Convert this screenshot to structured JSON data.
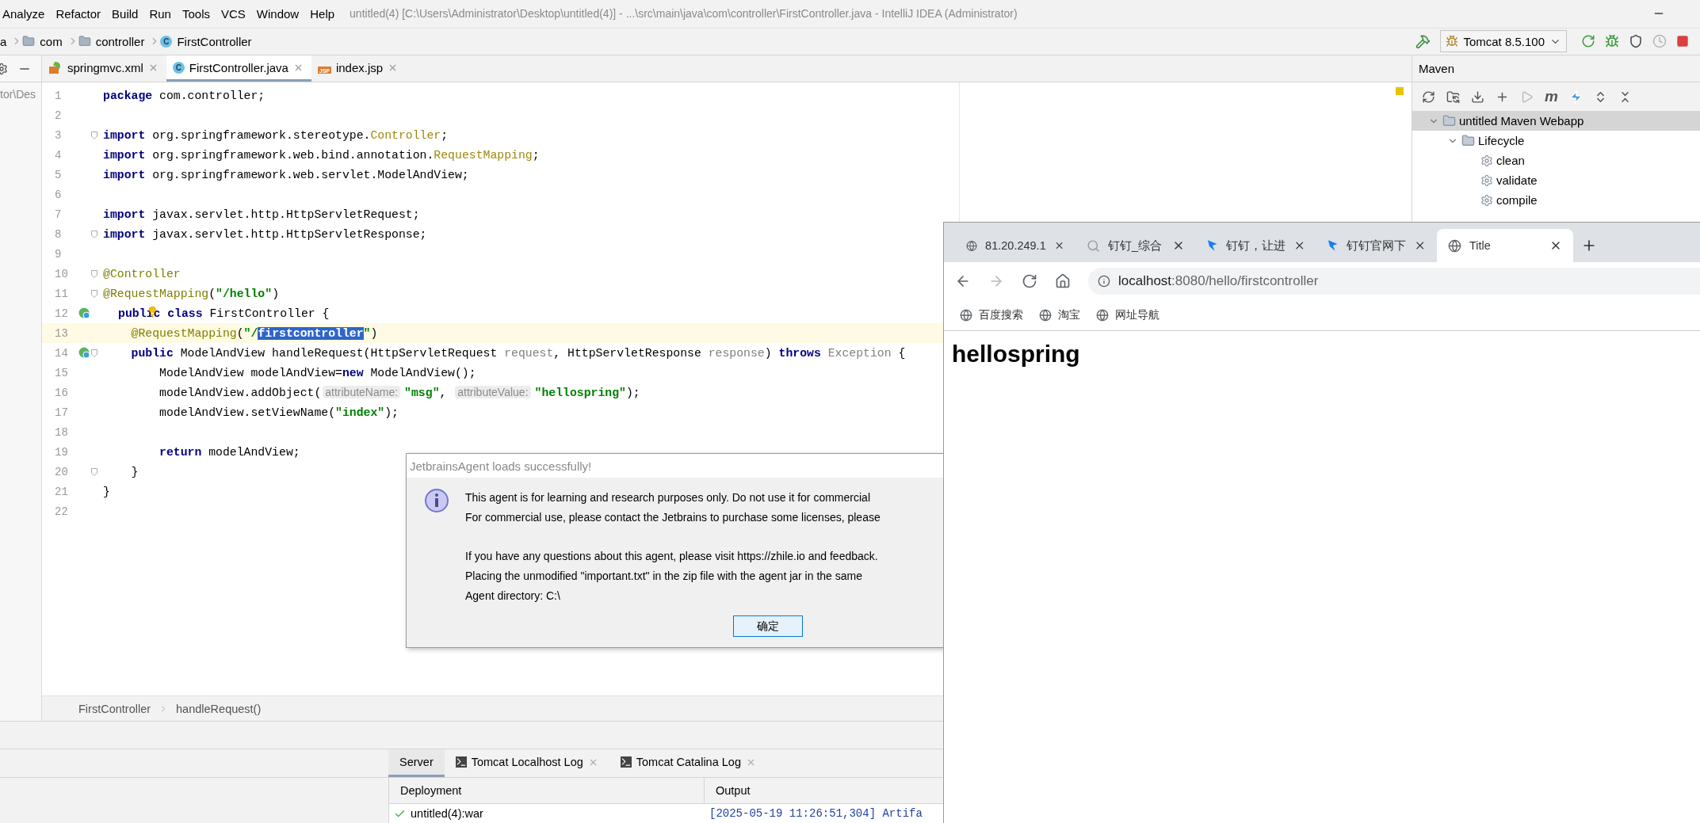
{
  "menu": [
    "Analyze",
    "Refactor",
    "Build",
    "Run",
    "Tools",
    "VCS",
    "Window",
    "Help"
  ],
  "window": {
    "title": "untitled(4) [C:\\Users\\Administrator\\Desktop\\untitled(4)] - ...\\src\\main\\java\\com\\controller\\FirstController.java - IntelliJ IDEA (Administrator)"
  },
  "breadcrumbs": [
    {
      "label": "a",
      "kind": "text"
    },
    {
      "label": "com",
      "kind": "folder"
    },
    {
      "label": "controller",
      "kind": "folder"
    },
    {
      "label": "FirstController",
      "kind": "class",
      "badge": "C"
    }
  ],
  "run_config": {
    "label": "Tomcat 8.5.100"
  },
  "project_panel": {
    "path": "tor\\Des"
  },
  "editor_tabs": [
    {
      "label": "springmvc.xml",
      "kind": "xml",
      "selected": false
    },
    {
      "label": "FirstController.java",
      "kind": "class",
      "badge": "C",
      "selected": true
    },
    {
      "label": "index.jsp",
      "kind": "jsp",
      "badge": "JSP",
      "selected": false
    }
  ],
  "code": [
    {
      "n": "1",
      "tokens": [
        {
          "t": "package ",
          "kind": "kw"
        },
        {
          "t": "com.controller;",
          "kind": "plain"
        }
      ]
    },
    {
      "n": "2"
    },
    {
      "n": "3",
      "fold": true,
      "tokens": [
        {
          "t": "import ",
          "kind": "kw"
        },
        {
          "t": "org.springframework.stereotype.",
          "kind": "plain"
        },
        {
          "t": "Controller",
          "kind": "imp"
        },
        {
          "t": ";",
          "kind": "plain"
        }
      ]
    },
    {
      "n": "4",
      "tokens": [
        {
          "t": "import ",
          "kind": "kw"
        },
        {
          "t": "org.springframework.web.bind.annotation.",
          "kind": "plain"
        },
        {
          "t": "RequestMapping",
          "kind": "imp"
        },
        {
          "t": ";",
          "kind": "plain"
        }
      ]
    },
    {
      "n": "5",
      "tokens": [
        {
          "t": "import ",
          "kind": "kw"
        },
        {
          "t": "org.springframework.web.servlet.ModelAndView;",
          "kind": "plain"
        }
      ]
    },
    {
      "n": "6"
    },
    {
      "n": "7",
      "tokens": [
        {
          "t": "import ",
          "kind": "kw"
        },
        {
          "t": "javax.servlet.http.HttpServletRequest;",
          "kind": "plain"
        }
      ]
    },
    {
      "n": "8",
      "fold": true,
      "tokens": [
        {
          "t": "import ",
          "kind": "kw"
        },
        {
          "t": "javax.servlet.http.HttpServletResponse;",
          "kind": "plain"
        }
      ]
    },
    {
      "n": "9"
    },
    {
      "n": "10",
      "fold": true,
      "tokens": [
        {
          "t": "@Controller",
          "kind": "ann"
        }
      ]
    },
    {
      "n": "11",
      "fold": true,
      "tokens": [
        {
          "t": "@RequestMapping",
          "kind": "ann"
        },
        {
          "t": "(",
          "kind": "plain"
        },
        {
          "t": "\"/hello\"",
          "kind": "str"
        },
        {
          "t": ")",
          "kind": "plain"
        }
      ]
    },
    {
      "n": "12",
      "run_marker": true,
      "bulb": true,
      "tokens": [
        {
          "t": "public ",
          "kind": "kw"
        },
        {
          "t": "class ",
          "kind": "kw"
        },
        {
          "t": "FirstController {",
          "kind": "plain"
        }
      ]
    },
    {
      "n": "13",
      "current": true,
      "tokens": [
        {
          "t": "    @RequestMapping",
          "kind": "ann"
        },
        {
          "t": "(",
          "kind": "plain"
        },
        {
          "t": "\"/",
          "kind": "str"
        },
        {
          "t": "firstcontroller",
          "kind": "sel"
        },
        {
          "t": "\"",
          "kind": "str"
        },
        {
          "t": ")",
          "kind": "plain"
        }
      ]
    },
    {
      "n": "14",
      "run_marker": true,
      "fold": true,
      "tokens": [
        {
          "t": "    public ",
          "kind": "kw"
        },
        {
          "t": "ModelAndView handleRequest(HttpServletRequest ",
          "kind": "plain"
        },
        {
          "t": "request",
          "kind": "gray"
        },
        {
          "t": ", HttpServletResponse ",
          "kind": "plain"
        },
        {
          "t": "response",
          "kind": "gray"
        },
        {
          "t": ") ",
          "kind": "plain"
        },
        {
          "t": "throws ",
          "kind": "kw"
        },
        {
          "t": "Exception",
          "kind": "gray"
        },
        {
          "t": " {",
          "kind": "plain"
        }
      ]
    },
    {
      "n": "15",
      "tokens": [
        {
          "t": "        ModelAndView modelAndView=",
          "kind": "plain"
        },
        {
          "t": "new ",
          "kind": "kw"
        },
        {
          "t": "ModelAndView();",
          "kind": "plain"
        }
      ]
    },
    {
      "n": "16",
      "tokens": [
        {
          "t": "        modelAndView.addObject(",
          "kind": "plain"
        },
        {
          "t": "attributeName:",
          "kind": "hint"
        },
        {
          "t": "\"msg\"",
          "kind": "str"
        },
        {
          "t": ", ",
          "kind": "plain"
        },
        {
          "t": "attributeValue:",
          "kind": "hint"
        },
        {
          "t": "\"hellospring\"",
          "kind": "str"
        },
        {
          "t": ");",
          "kind": "plain"
        }
      ]
    },
    {
      "n": "17",
      "tokens": [
        {
          "t": "        modelAndView.setViewName(",
          "kind": "plain"
        },
        {
          "t": "\"index\"",
          "kind": "str"
        },
        {
          "t": ");",
          "kind": "plain"
        }
      ]
    },
    {
      "n": "18"
    },
    {
      "n": "19",
      "tokens": [
        {
          "t": "        return ",
          "kind": "kw"
        },
        {
          "t": "modelAndView;",
          "kind": "plain"
        }
      ]
    },
    {
      "n": "20",
      "fold": true,
      "tokens": [
        {
          "t": "    }",
          "kind": "plain"
        }
      ]
    },
    {
      "n": "21",
      "tokens": [
        {
          "t": "}",
          "kind": "plain"
        }
      ]
    },
    {
      "n": "22"
    }
  ],
  "editor_breadcrumb": [
    "FirstController",
    "handleRequest()"
  ],
  "maven": {
    "title": "Maven",
    "toolbar_glyph": "m",
    "tree": [
      {
        "label": "untitled Maven Webapp",
        "kind": "project",
        "expanded": true,
        "selected": true,
        "children": [
          {
            "label": "Lifecycle",
            "kind": "folder",
            "expanded": true,
            "selected": false,
            "children": [
              {
                "label": "clean",
                "kind": "goal",
                "selected": false
              },
              {
                "label": "validate",
                "kind": "goal",
                "selected": false
              },
              {
                "label": "compile",
                "kind": "goal",
                "selected": false
              }
            ]
          }
        ]
      }
    ]
  },
  "services": {
    "tabs": [
      {
        "label": "Server",
        "kind": "plain",
        "selected": true
      },
      {
        "label": "Tomcat Localhost Log",
        "kind": "log",
        "selected": false
      },
      {
        "label": "Tomcat Catalina Log",
        "kind": "log",
        "selected": false
      }
    ],
    "columns": [
      "Deployment",
      "Output"
    ],
    "deployments": [
      {
        "label": "untitled(4):war",
        "deployed": true
      }
    ],
    "output": [
      "[2025-05-19 11:26:51,304] Artifa"
    ]
  },
  "dialog": {
    "title": "JetbrainsAgent loads successfully!",
    "paragraphs": [
      [
        "This agent is for learning and research purposes only. Do not use it for commercial",
        "For commercial use, please contact the Jetbrains to purchase some licenses, please"
      ],
      [
        "If you have any questions about this agent, please visit https://zhile.io and feedback.",
        "Placing the unmodified \"important.txt\" in the zip file with the agent jar in the same",
        "Agent directory: C:\\"
      ]
    ],
    "button": "确定"
  },
  "browser": {
    "tabs": [
      {
        "title": "81.20.249.1",
        "kind": "globe",
        "selected": false
      },
      {
        "title": "钉钉_综合",
        "kind": "search",
        "selected": false
      },
      {
        "title": "钉钉，让进",
        "kind": "dingtalk",
        "selected": false
      },
      {
        "title": "钉钉官网下",
        "kind": "dingtalk",
        "selected": false
      },
      {
        "title": "Title",
        "kind": "globe",
        "selected": true
      }
    ],
    "nav": [
      {
        "kind": "back",
        "disabled": false
      },
      {
        "kind": "forward",
        "disabled": true
      },
      {
        "kind": "reload",
        "disabled": false
      },
      {
        "kind": "home",
        "disabled": false
      }
    ],
    "address": {
      "host": "localhost",
      "path": ":8080/hello/firstcontroller"
    },
    "bookmarks": [
      "百度搜索",
      "淘宝",
      "网址导航"
    ],
    "heading": "hellospring"
  }
}
